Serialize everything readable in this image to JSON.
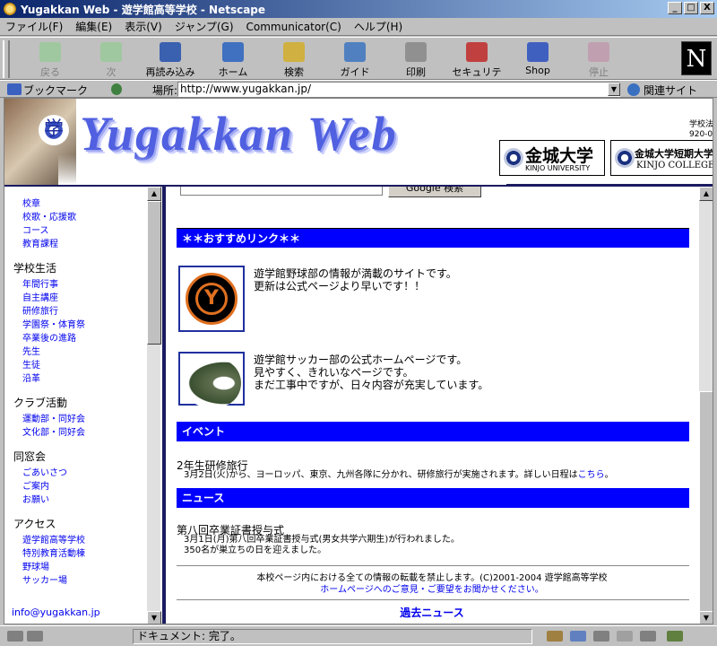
{
  "window": {
    "title": "Yugakkan Web - 遊学館高等学校 - Netscape",
    "min": "_",
    "max": "□",
    "close": "X"
  },
  "menu": [
    "ファイル(F)",
    "編集(E)",
    "表示(V)",
    "ジャンプ(G)",
    "Communicator(C)",
    "ヘルプ(H)"
  ],
  "toolbar": {
    "back": "戻る",
    "forward": "次",
    "reload": "再読み込み",
    "home": "ホーム",
    "search": "検索",
    "guide": "ガイド",
    "print": "印刷",
    "security": "セキュリティ",
    "shop": "Shop",
    "stop": "停止",
    "logo": "N"
  },
  "location": {
    "bookmarks": "ブックマーク",
    "label": "場所:",
    "url": "http://www.yugakkan.jp/",
    "related": "関連サイト"
  },
  "banner": {
    "title": "Yugakkan Web",
    "emblem": "学",
    "kinjo_univ": "金城大学",
    "kinjo_univ_en": "KINJO UNIVERSITY",
    "kinjo_college": "金城大学短期大学部",
    "kinjo_college_en": "KINJO COLLEGE",
    "side_text": "学校法\n920-0"
  },
  "sidebar": {
    "top_links": [
      "校章",
      "校歌・応援歌",
      "コース",
      "教育課程"
    ],
    "sections": [
      {
        "title": "学校生活",
        "links": [
          "年間行事",
          "自主講座",
          "研修旅行",
          "学園祭・体育祭",
          "卒業後の進路",
          "先生",
          "生徒",
          "沿革"
        ]
      },
      {
        "title": "クラブ活動",
        "links": [
          "運動部・同好会",
          "文化部・同好会"
        ]
      },
      {
        "title": "同窓会",
        "links": [
          "ごあいさつ",
          "ご案内",
          "お願い"
        ]
      },
      {
        "title": "アクセス",
        "links": [
          "遊学館高等学校",
          "特別教育活動棟",
          "野球場",
          "サッカー場"
        ]
      }
    ],
    "email": "info@yugakkan.jp"
  },
  "main": {
    "search_button": "Google 検索",
    "recommend_header": "＊＊おすすめリンク＊＊",
    "links": [
      {
        "desc": "遊学館野球部の情報が満載のサイトです。\n更新は公式ページより早いです！！",
        "logo": "Y"
      },
      {
        "desc": "遊学館サッカー部の公式ホームページです。\n見やすく、きれいなページです。\nまだ工事中ですが、日々内容が充実しています。"
      }
    ],
    "event_header": "イベント",
    "event_title": "2年生研修旅行",
    "event_text": "3月2日(火)から、ヨーロッパ、東京、九州各隊に分かれ、研修旅行が実施されます。詳しい日程は",
    "event_link": "こちら",
    "event_end": "。",
    "news_header": "ニュース",
    "news_title": "第八回卒業証書授与式",
    "news_text1": "3月1日(月)第八回卒業証書授与式(男女共学六期生)が行われました。",
    "news_text2": "350名が巣立ちの日を迎えました。",
    "footer1": "本校ページ内における全ての情報の転載を禁止します。(C)2001-2004 遊学館高等学校",
    "footer2": "ホームページへのご意見・ご要望をお聞かせください。",
    "past_news": "過去ニュース"
  },
  "status": {
    "text": "ドキュメント: 完了。"
  }
}
